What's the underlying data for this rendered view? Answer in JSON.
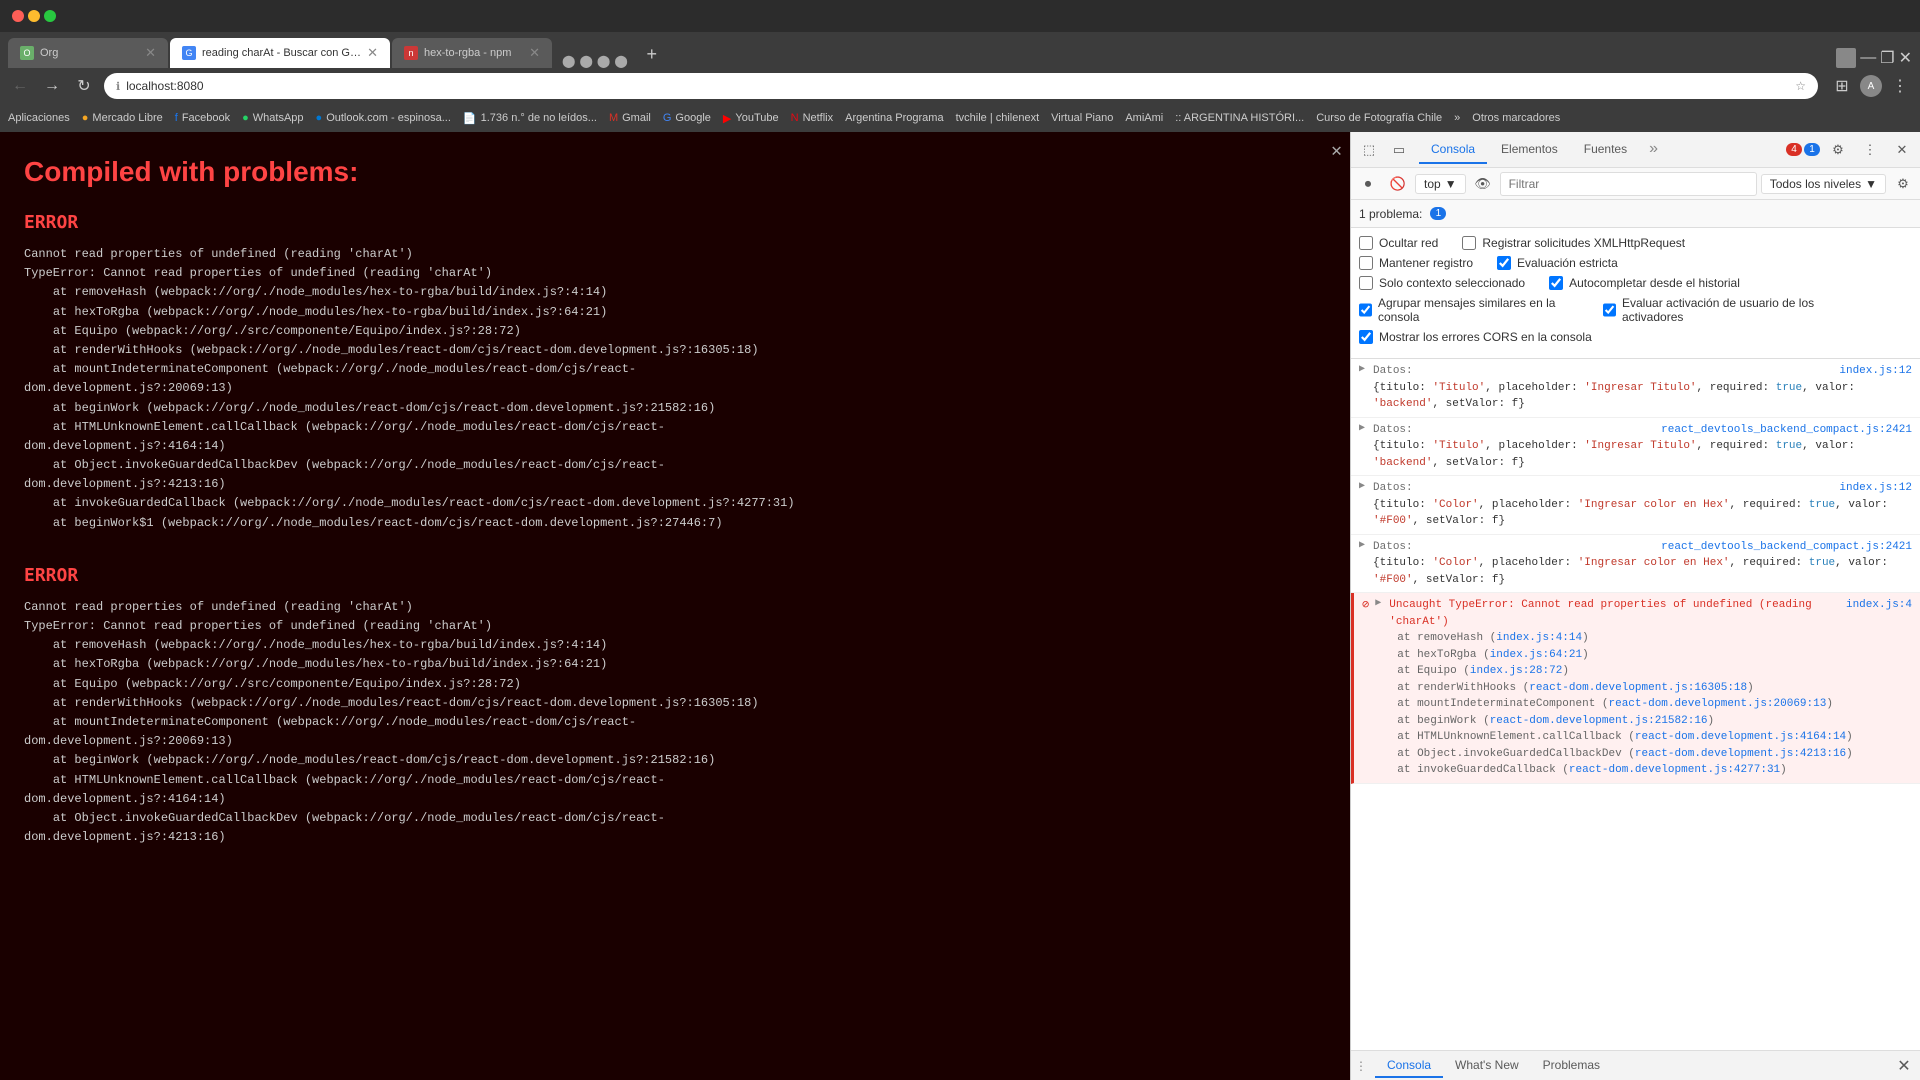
{
  "browser": {
    "tabs": [
      {
        "id": "tab1",
        "title": "Org",
        "favicon_color": "#6aaf6a",
        "active": false,
        "favicon_text": "O"
      },
      {
        "id": "tab2",
        "title": "reading charAt - Buscar con Google",
        "favicon_color": "#4285f4",
        "active": true,
        "favicon_text": "G"
      },
      {
        "id": "tab3",
        "title": "hex-to-rgba - npm",
        "favicon_color": "#cb3837",
        "active": false,
        "favicon_text": "n"
      },
      {
        "id": "tab4",
        "title": "...",
        "favicon_color": "#888",
        "active": false,
        "favicon_text": "·"
      }
    ],
    "new_tab_label": "+",
    "address": "localhost:8080",
    "nav": {
      "back": "←",
      "forward": "→",
      "reload": "↻",
      "home": "⌂"
    },
    "bookmarks": [
      "Aplicaciones",
      "Mercado Libre",
      "Facebook",
      "WhatsApp",
      "Outlook.com - espinosa...",
      "1.736 n.° de no leídos...",
      "Gmail",
      "Google",
      "YouTube",
      "Netflix",
      "Argentina Programa",
      "tvchile | chilenext",
      "Virtual Piano",
      "AmiAmi",
      ":: ARGENTINA HISTÓRI...",
      "Curso de Fotografía Chile",
      "»",
      "Otros marcadores"
    ]
  },
  "error_page": {
    "title": "Compiled with problems:",
    "errors": [
      {
        "label": "ERROR",
        "text": "Cannot read properties of undefined (reading 'charAt')\nTypeError: Cannot read properties of undefined (reading 'charAt')\n    at removeHash (webpack://org/./node_modules/hex-to-rgba/build/index.js?:4:14)\n    at hexToRgba (webpack://org/./node_modules/hex-to-rgba/build/index.js?:64:21)\n    at Equipo (webpack://org/./src/componente/Equipo/index.js?:28:72)\n    at renderWithHooks (webpack://org/./node_modules/react-dom/cjs/react-dom.development.js?:16305:18)\n    at mountIndeterminateComponent (webpack://org/./node_modules/react-dom/cjs/react-\ndom.development.js?:20069:13)\n    at beginWork (webpack://org/./node_modules/react-dom/cjs/react-dom.development.js?:21582:16)\n    at HTMLUnknownElement.callCallback (webpack://org/./node_modules/react-dom/cjs/react-\ndom.development.js?:4164:14)\n    at Object.invokeGuardedCallbackDev (webpack://org/./node_modules/react-dom/cjs/react-\ndom.development.js?:4213:16)\n    at invokeGuardedCallback (webpack://org/./node_modules/react-dom/cjs/react-dom.development.js?:4277:31)\n    at beginWork$1 (webpack://org/./node_modules/react-dom/cjs/react-dom.development.js?:27446:7)"
      },
      {
        "label": "ERROR",
        "text": "Cannot read properties of undefined (reading 'charAt')\nTypeError: Cannot read properties of undefined (reading 'charAt')\n    at removeHash (webpack://org/./node_modules/hex-to-rgba/build/index.js?:4:14)\n    at hexToRgba (webpack://org/./node_modules/hex-to-rgba/build/index.js?:64:21)\n    at Equipo (webpack://org/./src/componente/Equipo/index.js?:28:72)\n    at renderWithHooks (webpack://org/./node_modules/react-dom/cjs/react-dom.development.js?:16305:18)\n    at mountIndeterminateComponent (webpack://org/./node_modules/react-dom/cjs/react-\ndom.development.js?:20069:13)\n    at beginWork (webpack://org/./node_modules/react-dom/cjs/react-dom.development.js?:21582:16)\n    at HTMLUnknownElement.callCallback (webpack://org/./node_modules/react-dom/cjs/react-\ndom.development.js?:4164:14)\n    at Object.invokeGuardedCallbackDev (webpack://org/./node_modules/react-dom/cjs/react-\ndom.development.js?:4213:16)"
      }
    ]
  },
  "devtools": {
    "tabs": [
      "Consola",
      "Elementos",
      "Fuentes"
    ],
    "active_tab": "Consola",
    "more_label": "»",
    "badges": {
      "error_count": "4",
      "warning_count": "1"
    },
    "icons": {
      "inspect": "⬚",
      "device": "▭",
      "settings_gear": "⚙",
      "menu": "⋮",
      "close": "✕",
      "record": "⏺",
      "clear": "🚫",
      "expand": "❯",
      "block": "⊘",
      "eye": "👁"
    },
    "console_toolbar": {
      "top_label": "top",
      "filter_placeholder": "Filtrar",
      "level_label": "Todos los niveles"
    },
    "problems_bar": {
      "text": "1 problema:",
      "count": "1"
    },
    "settings": {
      "checkboxes": [
        {
          "label": "Ocultar red",
          "checked": false
        },
        {
          "label": "Registrar solicitudes XMLHttpRequest",
          "checked": false
        },
        {
          "label": "Mantener registro",
          "checked": false
        },
        {
          "label": "Evaluación estricta",
          "checked": true
        },
        {
          "label": "Solo contexto seleccionado",
          "checked": false
        },
        {
          "label": "Autocompletar desde el historial",
          "checked": true
        },
        {
          "label": "Agrupar mensajes similares en la consola",
          "checked": true
        },
        {
          "label": "Evaluar activación de usuario de los activadores",
          "checked": true
        },
        {
          "label": "Mostrar los errores CORS en la consola",
          "checked": true
        }
      ]
    },
    "log_entries": [
      {
        "type": "datos",
        "label": "Datos:",
        "filename": "index.js:12",
        "value": "{titulo: 'Titulo', placeholder: 'Ingresar Titulo', required: true, valor: 'backend', setValor: f}",
        "expanded": true
      },
      {
        "type": "datos",
        "label": "Datos:",
        "filename": "react_devtools_backend_compact.js:2421",
        "value": "{titulo: 'Titulo', placeholder: 'Ingresar Titulo', required: true, valor: 'backend', setValor: f}",
        "expanded": true
      },
      {
        "type": "datos",
        "label": "Datos:",
        "filename": "index.js:12",
        "value": "{titulo: 'Color', placeholder: 'Ingresar color en Hex', required: true, valor: '#F00', setValor: f}",
        "expanded": true
      },
      {
        "type": "datos",
        "label": "Datos:",
        "filename": "react_devtools_backend_compact.js:2421",
        "value": "{titulo: 'Color', placeholder: 'Ingresar color en Hex', required: true, valor: '#F00', setValor: f}",
        "expanded": true
      },
      {
        "type": "error",
        "label": "Uncaught TypeError: Cannot read properties of undefined (reading 'charAt')",
        "filename": "index.js:4",
        "details": [
          "at removeHash (index.js:4:14)",
          "at hexToRgba (index.js:64:21)",
          "at Equipo (index.js:28:72)",
          "at renderWithHooks (react-dom.development.js:16305:18)",
          "at mountIndeterminateComponent (react-dom.development.js:20069:13)",
          "at beginWork (react-dom.development.js:21582:16)",
          "at HTMLUnknownElement.callCallback (react-dom.development.js:4164:14)",
          "at Object.invokeGuardedCallbackDev (react-dom.development.js:4213:16)",
          "at invokeGuardedCallback (react-dom.development.js:4277:31)"
        ]
      }
    ],
    "bottom_tabs": [
      "Consola",
      "What's New",
      "Problemas"
    ],
    "bottom_active_tab": "Consola"
  }
}
